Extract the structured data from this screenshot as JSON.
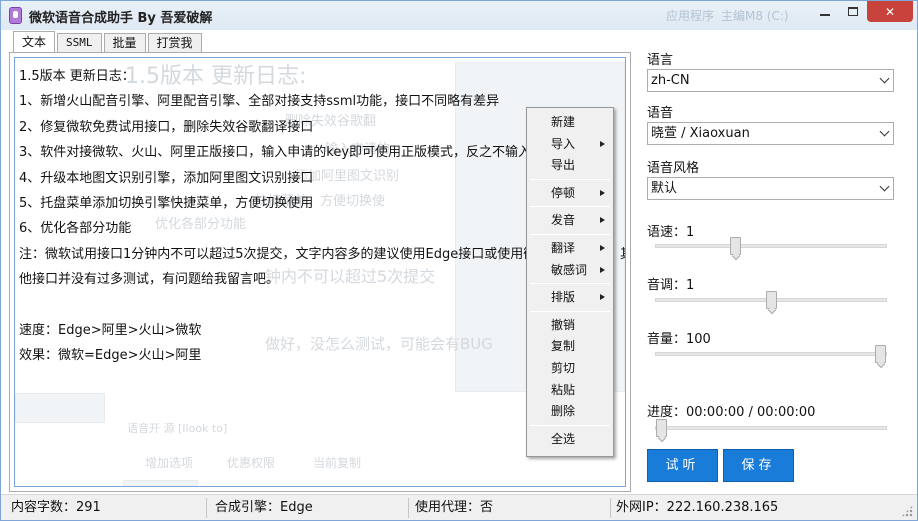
{
  "window": {
    "title": "微软语音合成助手 By 吾爱破解",
    "ghost_titles": [
      "主编M8 (C:)",
      "应用程序"
    ]
  },
  "tabs": [
    {
      "label": "文本",
      "active": true
    },
    {
      "label": "SSML",
      "active": false
    },
    {
      "label": "批量",
      "active": false
    },
    {
      "label": "打赏我",
      "active": false
    }
  ],
  "editor": {
    "lines": [
      "1.5版本 更新日志：",
      "1、新增火山配音引擎、阿里配音引擎、全部对接支持ssml功能，接口不同略有差异",
      "2、修复微软免费试用接口，删除失效谷歌翻译接口",
      "3、软件对接微软、火山、阿里正版接口，输入申请的key即可使用正版模式，反之不输入",
      "4、升级本地图文识别引擎，添加阿里图文识别接口",
      "5、托盘菜单添加切换引擎快捷菜单，方便切换使用",
      "6、优化各部分功能",
      "注：微软试用接口1分钟内不可以超过5次提交，文字内容多的建议使用Edge接口或使用微",
      "他接口并没有过多测试，有问题给我留言吧。",
      "",
      "速度：Edge>阿里>火山>微软",
      "效果：微软=Edge>火山>阿里"
    ],
    "overflow_char": "其",
    "ghost_text": {
      "heading": "1.5版本 更新日志:",
      "l2": "删除失效谷歌翻",
      "l3": "输入申请的",
      "l4": "添加阿里图文识别",
      "l5": "快捷菜单，方便切换使",
      "l6": "优化各部分功能",
      "l8": "钟内不可以超过5次提交",
      "l10": "做好，没怎么测试，可能会有BUG",
      "l11": "语音开 源 [Ilook to]",
      "b1": "增加选项",
      "b2": "优惠权限",
      "b3": "当前复制"
    }
  },
  "context_menu": {
    "items": [
      {
        "label": "新建",
        "submenu": false
      },
      {
        "label": "导入",
        "submenu": true
      },
      {
        "label": "导出",
        "submenu": false
      },
      {
        "sep": true
      },
      {
        "label": "停顿",
        "submenu": true
      },
      {
        "sep": true
      },
      {
        "label": "发音",
        "submenu": true
      },
      {
        "sep": true
      },
      {
        "label": "翻译",
        "submenu": true
      },
      {
        "label": "敏感词",
        "submenu": true
      },
      {
        "sep": true
      },
      {
        "label": "排版",
        "submenu": true
      },
      {
        "sep": true
      },
      {
        "label": "撤销",
        "submenu": false
      },
      {
        "label": "复制",
        "submenu": false
      },
      {
        "label": "剪切",
        "submenu": false
      },
      {
        "label": "粘贴",
        "submenu": false
      },
      {
        "label": "删除",
        "submenu": false
      },
      {
        "sep": true
      },
      {
        "label": "全选",
        "submenu": false
      }
    ]
  },
  "settings": {
    "language_label": "语言",
    "language_value": "zh-CN",
    "voice_label": "语音",
    "voice_value": "晓萱 / Xiaoxuan",
    "style_label": "语音风格",
    "style_value": "默认",
    "rate_label": "语速：1",
    "rate_level": 0.34,
    "pitch_label": "音调：1",
    "pitch_level": 0.5,
    "volume_label": "音量：100",
    "volume_level": 1.0,
    "progress_label": "进度：00:00:00 / 00:00:00",
    "progress_level": 0.0,
    "listen_button": "试听",
    "save_button": "保存"
  },
  "status": {
    "chars": "内容字数：291",
    "engine": "合成引擎：Edge",
    "proxy": "使用代理：否",
    "ip": "外网IP：222.160.238.165"
  },
  "colors": {
    "accent": "#1a7cd9",
    "close": "#c7433b"
  }
}
